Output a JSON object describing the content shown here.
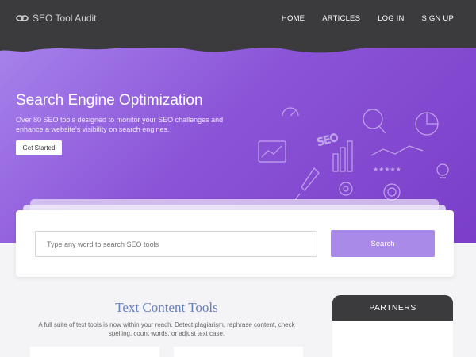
{
  "brand": {
    "name": "SEO Tool Audit",
    "icon": "links-icon"
  },
  "nav": {
    "items": [
      "HOME",
      "ARTICLES",
      "LOG IN",
      "SIGN UP"
    ]
  },
  "hero": {
    "title": "Search Engine Optimization",
    "description": "Over 80 SEO tools designed to monitor your SEO challenges and enhance a website's visibility on search engines.",
    "cta_label": "Get Started",
    "illustration_text": "SEO",
    "illustration_icon": "seo-icons-illustration"
  },
  "search": {
    "placeholder": "Type any word to search SEO tools",
    "button_label": "Search"
  },
  "section": {
    "title": "Text Content Tools",
    "description": "A full suite of text tools is now within your reach. Detect plagiarism, rephrase content, check spelling, count words, or adjust text case."
  },
  "sidebar": {
    "partners_title": "PARTNERS"
  },
  "colors": {
    "nav_bg": "#3b3b3d",
    "hero_start": "#a884ec",
    "hero_end": "#7a3ec8",
    "accent_button": "#a98ae8",
    "section_title": "#6480c2"
  }
}
